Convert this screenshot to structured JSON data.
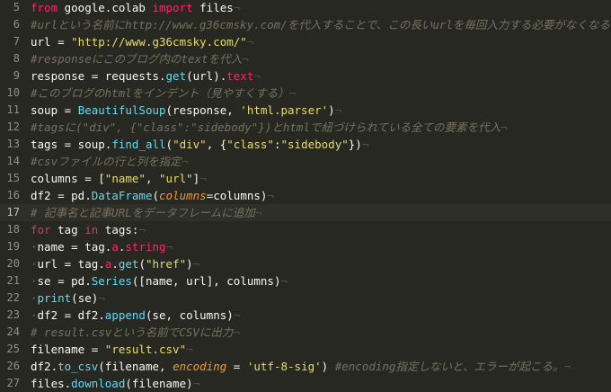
{
  "editor": {
    "lines": [
      {
        "no": "5",
        "tokens": [
          {
            "t": "from",
            "c": "kw"
          },
          {
            "t": " google.colab ",
            "c": "tx"
          },
          {
            "t": "import",
            "c": "kw"
          },
          {
            "t": " files",
            "c": "tx"
          },
          {
            "t": "¬",
            "c": "eol"
          }
        ]
      },
      {
        "no": "6",
        "tokens": [
          {
            "t": "#urlという名前にhttp://www.g36cmsky.com/を代入することで、この長いurlを毎回入力する必要がなくなる",
            "c": "cm"
          },
          {
            "t": "¬",
            "c": "eol"
          }
        ]
      },
      {
        "no": "7",
        "tokens": [
          {
            "t": "url = ",
            "c": "tx"
          },
          {
            "t": "\"http://www.g36cmsky.com/\"",
            "c": "str"
          },
          {
            "t": "¬",
            "c": "eol"
          }
        ]
      },
      {
        "no": "8",
        "tokens": [
          {
            "t": "#responseにこのブログ内のtextを代入",
            "c": "cm"
          },
          {
            "t": "¬",
            "c": "eol"
          }
        ]
      },
      {
        "no": "9",
        "tokens": [
          {
            "t": "response = requests.",
            "c": "tx"
          },
          {
            "t": "get",
            "c": "fn"
          },
          {
            "t": "(url).",
            "c": "tx"
          },
          {
            "t": "text",
            "c": "prop"
          },
          {
            "t": "¬",
            "c": "eol"
          }
        ]
      },
      {
        "no": "10",
        "tokens": [
          {
            "t": "#このブログのhtmlをインデント（見やすくする）",
            "c": "cm"
          },
          {
            "t": "¬",
            "c": "eol"
          }
        ]
      },
      {
        "no": "11",
        "tokens": [
          {
            "t": "soup = ",
            "c": "tx"
          },
          {
            "t": "BeautifulSoup",
            "c": "fn"
          },
          {
            "t": "(response, ",
            "c": "tx"
          },
          {
            "t": "'html.parser'",
            "c": "str"
          },
          {
            "t": ")",
            "c": "tx"
          },
          {
            "t": "¬",
            "c": "eol"
          }
        ]
      },
      {
        "no": "12",
        "tokens": [
          {
            "t": "#tagsに(\"div\", {\"class\":\"sidebody\"})とhtmlで紐づけられている全ての要素を代入",
            "c": "cm"
          },
          {
            "t": "¬",
            "c": "eol"
          }
        ]
      },
      {
        "no": "13",
        "tokens": [
          {
            "t": "tags = soup.",
            "c": "tx"
          },
          {
            "t": "find_all",
            "c": "fn"
          },
          {
            "t": "(",
            "c": "tx"
          },
          {
            "t": "\"div\"",
            "c": "str"
          },
          {
            "t": ", {",
            "c": "tx"
          },
          {
            "t": "\"class\"",
            "c": "str"
          },
          {
            "t": ":",
            "c": "tx"
          },
          {
            "t": "\"sidebody\"",
            "c": "str"
          },
          {
            "t": "})",
            "c": "tx"
          },
          {
            "t": "¬",
            "c": "eol"
          }
        ]
      },
      {
        "no": "14",
        "tokens": [
          {
            "t": "#csvファイルの行と列を指定",
            "c": "cm"
          },
          {
            "t": "¬",
            "c": "eol"
          }
        ]
      },
      {
        "no": "15",
        "tokens": [
          {
            "t": "columns = [",
            "c": "tx"
          },
          {
            "t": "\"name\"",
            "c": "str"
          },
          {
            "t": ", ",
            "c": "tx"
          },
          {
            "t": "\"url\"",
            "c": "str"
          },
          {
            "t": "]",
            "c": "tx"
          },
          {
            "t": "¬",
            "c": "eol"
          }
        ]
      },
      {
        "no": "16",
        "tokens": [
          {
            "t": "df2 = pd.",
            "c": "tx"
          },
          {
            "t": "DataFrame",
            "c": "fn"
          },
          {
            "t": "(",
            "c": "tx"
          },
          {
            "t": "columns",
            "c": "param"
          },
          {
            "t": "=columns)",
            "c": "tx"
          },
          {
            "t": "¬",
            "c": "eol"
          }
        ]
      },
      {
        "no": "17",
        "active": true,
        "tokens": [
          {
            "t": "# 記事名と記事URLをデータフレームに追加",
            "c": "cm"
          },
          {
            "t": "¬",
            "c": "eol"
          }
        ]
      },
      {
        "no": "18",
        "tokens": [
          {
            "t": "for",
            "c": "kw"
          },
          {
            "t": " tag ",
            "c": "tx"
          },
          {
            "t": "in",
            "c": "kw"
          },
          {
            "t": " tags:",
            "c": "tx"
          },
          {
            "t": "¬",
            "c": "eol"
          }
        ]
      },
      {
        "no": "19",
        "tokens": [
          {
            "t": "",
            "c": "ws"
          },
          {
            "t": "name = tag.",
            "c": "tx"
          },
          {
            "t": "a",
            "c": "prop"
          },
          {
            "t": ".",
            "c": "tx"
          },
          {
            "t": "string",
            "c": "prop"
          },
          {
            "t": "¬",
            "c": "eol"
          }
        ]
      },
      {
        "no": "20",
        "tokens": [
          {
            "t": "",
            "c": "ws"
          },
          {
            "t": "url = tag.",
            "c": "tx"
          },
          {
            "t": "a",
            "c": "prop"
          },
          {
            "t": ".",
            "c": "tx"
          },
          {
            "t": "get",
            "c": "fn"
          },
          {
            "t": "(",
            "c": "tx"
          },
          {
            "t": "\"href\"",
            "c": "str"
          },
          {
            "t": ")",
            "c": "tx"
          },
          {
            "t": "¬",
            "c": "eol"
          }
        ]
      },
      {
        "no": "21",
        "tokens": [
          {
            "t": "",
            "c": "ws"
          },
          {
            "t": "se = pd.",
            "c": "tx"
          },
          {
            "t": "Series",
            "c": "fn"
          },
          {
            "t": "([name, url], columns)",
            "c": "tx"
          },
          {
            "t": "¬",
            "c": "eol"
          }
        ]
      },
      {
        "no": "22",
        "tokens": [
          {
            "t": "",
            "c": "ws"
          },
          {
            "t": "print",
            "c": "fn"
          },
          {
            "t": "(se)",
            "c": "tx"
          },
          {
            "t": "¬",
            "c": "eol"
          }
        ]
      },
      {
        "no": "23",
        "tokens": [
          {
            "t": "",
            "c": "ws"
          },
          {
            "t": "df2 = df2.",
            "c": "tx"
          },
          {
            "t": "append",
            "c": "fn"
          },
          {
            "t": "(se, columns)",
            "c": "tx"
          },
          {
            "t": "¬",
            "c": "eol"
          }
        ]
      },
      {
        "no": "24",
        "tokens": [
          {
            "t": "# result.csvという名前でCSVに出力",
            "c": "cm"
          },
          {
            "t": "¬",
            "c": "eol"
          }
        ]
      },
      {
        "no": "25",
        "tokens": [
          {
            "t": "filename = ",
            "c": "tx"
          },
          {
            "t": "\"result.csv\"",
            "c": "str"
          },
          {
            "t": "¬",
            "c": "eol"
          }
        ]
      },
      {
        "no": "26",
        "tokens": [
          {
            "t": "df2.",
            "c": "tx"
          },
          {
            "t": "to_csv",
            "c": "fn"
          },
          {
            "t": "(filename, ",
            "c": "tx"
          },
          {
            "t": "encoding",
            "c": "param"
          },
          {
            "t": " = ",
            "c": "tx"
          },
          {
            "t": "'utf-8-sig'",
            "c": "str"
          },
          {
            "t": ") ",
            "c": "tx"
          },
          {
            "t": "#encoding指定しないと、エラーが起こる。",
            "c": "cm"
          },
          {
            "t": "¬",
            "c": "eol"
          }
        ]
      },
      {
        "no": "27",
        "tokens": [
          {
            "t": "files.",
            "c": "tx"
          },
          {
            "t": "download",
            "c": "fn"
          },
          {
            "t": "(filename)",
            "c": "tx"
          },
          {
            "t": "¬",
            "c": "eol"
          }
        ]
      }
    ]
  }
}
